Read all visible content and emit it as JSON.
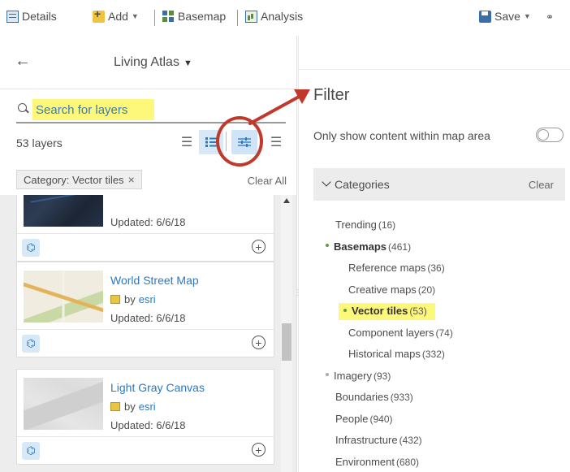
{
  "toolbar": {
    "details_label": "Details",
    "add_label": "Add",
    "basemap_label": "Basemap",
    "analysis_label": "Analysis",
    "save_label": "Save"
  },
  "left_panel": {
    "source_title": "Living Atlas",
    "search_placeholder": "Search for layers",
    "layer_count": "53 layers",
    "chip_label": "Category: Vector tiles",
    "chip_remove": "×",
    "clear_all": "Clear All",
    "cards": [
      {
        "title": "",
        "owner_prefix": "by",
        "owner": "",
        "updated": "Updated: 6/6/18"
      },
      {
        "title": "World Street Map",
        "owner_prefix": "by",
        "owner": "esri",
        "updated": "Updated: 6/6/18"
      },
      {
        "title": "Light Gray Canvas",
        "owner_prefix": "by",
        "owner": "esri",
        "updated": "Updated: 6/6/18"
      }
    ]
  },
  "filter_panel": {
    "title": "Filter",
    "map_area_label": "Only show content within map area",
    "map_area_toggle": false,
    "categories_title": "Categories",
    "categories_clear": "Clear",
    "categories": [
      {
        "label": "Trending",
        "count": "(16)",
        "level": 0,
        "bullet": "none",
        "bold": false,
        "highlight": false
      },
      {
        "label": "Basemaps",
        "count": "(461)",
        "level": 0,
        "bullet": "green",
        "bold": true,
        "highlight": false
      },
      {
        "label": "Reference maps",
        "count": "(36)",
        "level": 1,
        "bullet": "none",
        "bold": false,
        "highlight": false
      },
      {
        "label": "Creative maps",
        "count": "(20)",
        "level": 1,
        "bullet": "none",
        "bold": false,
        "highlight": false
      },
      {
        "label": "Vector tiles",
        "count": "(53)",
        "level": 1,
        "bullet": "green",
        "bold": true,
        "highlight": true
      },
      {
        "label": "Component layers",
        "count": "(74)",
        "level": 1,
        "bullet": "none",
        "bold": false,
        "highlight": false
      },
      {
        "label": "Historical maps",
        "count": "(332)",
        "level": 1,
        "bullet": "none",
        "bold": false,
        "highlight": false
      },
      {
        "label": "Imagery",
        "count": "(93)",
        "level": 0,
        "bullet": "gray",
        "bold": false,
        "highlight": false
      },
      {
        "label": "Boundaries",
        "count": "(933)",
        "level": 0,
        "bullet": "none",
        "bold": false,
        "highlight": false
      },
      {
        "label": "People",
        "count": "(940)",
        "level": 0,
        "bullet": "none",
        "bold": false,
        "highlight": false
      },
      {
        "label": "Infrastructure",
        "count": "(432)",
        "level": 0,
        "bullet": "none",
        "bold": false,
        "highlight": false
      },
      {
        "label": "Environment",
        "count": "(680)",
        "level": 0,
        "bullet": "none",
        "bold": false,
        "highlight": false
      }
    ]
  },
  "colors": {
    "accent_blue": "#2a79c2",
    "highlight_yellow": "#fdf77a",
    "annotation_red": "#c0392b",
    "selected_bullet_green": "#5aa23a"
  }
}
